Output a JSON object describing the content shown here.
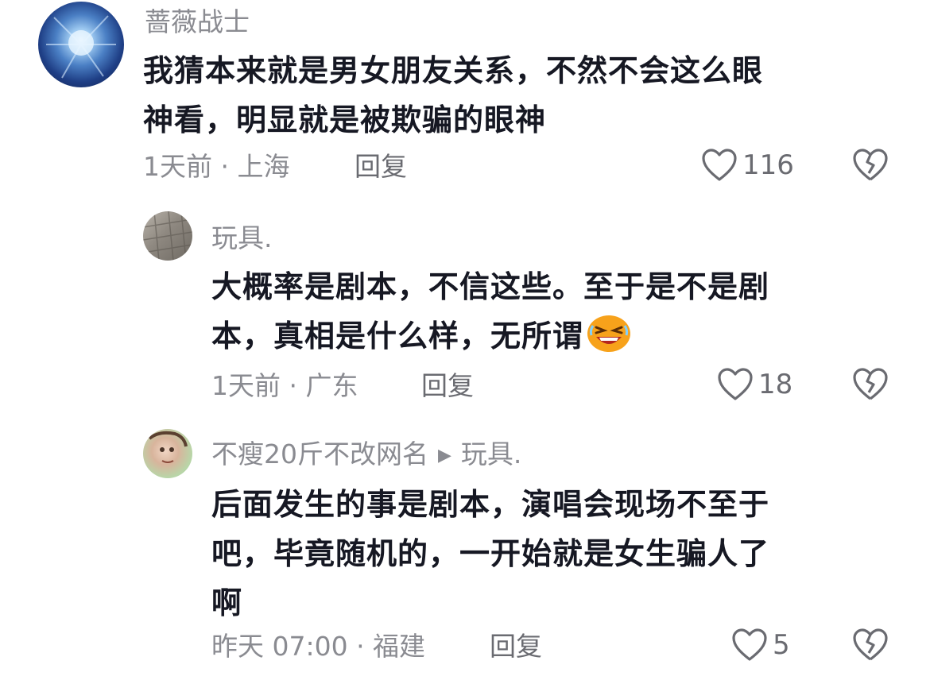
{
  "comments": [
    {
      "author": "蔷薇战士",
      "text_lines": [
        "我猜本来就是男女朋友关系，不然不会这么眼",
        "神看，明显就是被欺骗的眼神"
      ],
      "meta": "1天前 · 上海",
      "reply_label": "回复",
      "likes": "116"
    },
    {
      "author": "玩具.",
      "text_lines": [
        "大概率是剧本，不信这些。至于是不是剧",
        "本，真相是什么样，无所谓"
      ],
      "meta": "1天前 · 广东",
      "reply_label": "回复",
      "likes": "18",
      "emoji": "laughing-emoji"
    },
    {
      "author": "不瘦20斤不改网名",
      "reply_to": "玩具.",
      "text_lines": [
        "后面发生的事是剧本，演唱会现场不至于",
        "吧，毕竟随机的，一开始就是女生骗人了",
        "啊"
      ],
      "meta": "昨天 07:00 · 福建",
      "reply_label": "回复",
      "likes": "5"
    }
  ],
  "icons": {
    "like": "heart-outline-icon",
    "dislike": "broken-heart-icon",
    "reply_arrow": "play-triangle-icon"
  },
  "colors": {
    "text": "#161823",
    "secondary": "#8a8b91",
    "icon": "#6a6b71"
  }
}
